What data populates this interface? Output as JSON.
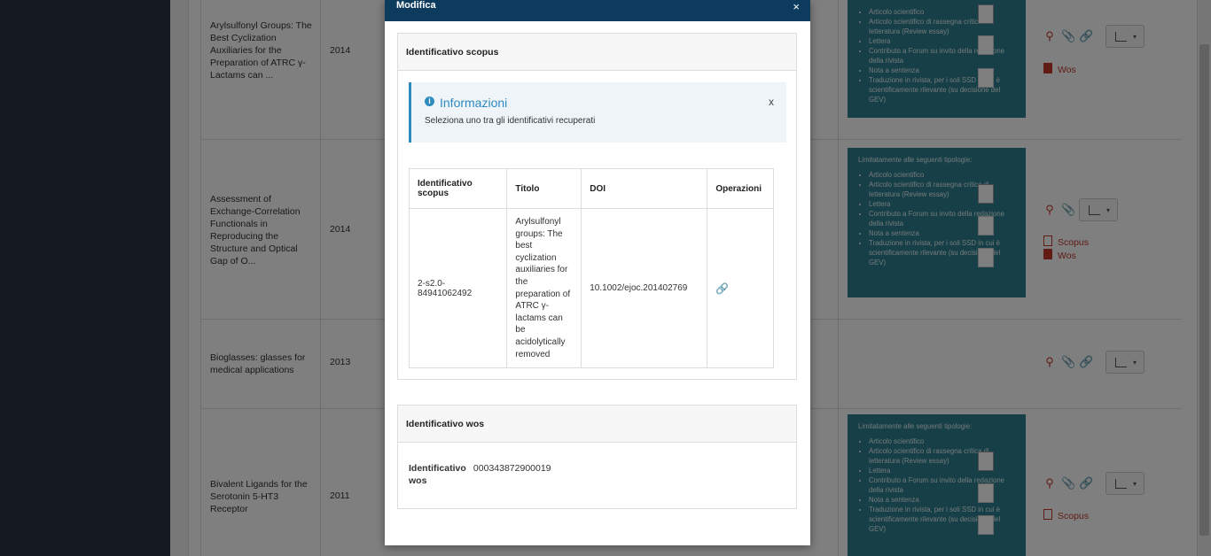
{
  "modal": {
    "title": "Modifica",
    "close": "×",
    "scopus_panel": {
      "heading": "Identificativo scopus",
      "alert": {
        "icon": "info-icon",
        "title": "Informazioni",
        "text": "Seleziona uno tra gli identificativi recuperati",
        "close": "x"
      },
      "table": {
        "headers": [
          "Identificativo scopus",
          "Titolo",
          "DOI",
          "Operazioni"
        ],
        "rows": [
          {
            "id": "2-s2.0-84941062492",
            "title": "Arylsulfonyl groups: The best cyclization auxiliaries for the preparation of ATRC γ-lactams can be acidolytically removed",
            "doi": "10.1002/ejoc.201402769",
            "operation_icon": "link-icon"
          }
        ]
      }
    },
    "wos_panel": {
      "heading": "Identificativo wos",
      "label": "Identificativo wos",
      "value": "000343872900019"
    }
  },
  "background": {
    "rows": [
      {
        "title": "Arylsulfonyl Groups: The Best Cyclization Auxiliaries for the Preparation of ATRC γ-Lactams can ...",
        "year": "2014",
        "files": [
          {
            "label": "Wos",
            "icon": "file-solid-icon"
          }
        ]
      },
      {
        "title": "Assessment of Exchange-Correlation Functionals in Reproducing the Structure and Optical Gap of O...",
        "year": "2014",
        "files": [
          {
            "label": "Scopus",
            "icon": "file-outline-icon"
          },
          {
            "label": "Wos",
            "icon": "file-solid-icon"
          }
        ]
      },
      {
        "title": "Bioglasses: glasses for medical applications",
        "year": "2013",
        "files": []
      },
      {
        "title": "Bivalent Ligands for the Serotonin 5-HT3 Receptor",
        "year": "2011",
        "files": [
          {
            "label": "Scopus",
            "icon": "file-outline-icon"
          }
        ]
      }
    ],
    "typology_box": {
      "header": "Limitatamente alle seguenti tipologie:",
      "items": [
        "Articolo scientifico",
        "Articolo scientifico di rassegna critica di letteratura (Review essay)",
        "Lettera",
        "Contributo a Forum su invito della redazione della rivista",
        "Nota a sentenza",
        "Traduzione in rivista, per i soli SSD in cui è scientificamente rilevante (su decisione del GEV)"
      ]
    },
    "actions": {
      "icons": [
        "zoom-icon",
        "paperclip-icon",
        "link-icon",
        "bar-chart-icon"
      ]
    },
    "accent_color": "#c0392b",
    "teal_color": "#2d7f8e",
    "modal_header_color": "#0d3b5e"
  }
}
